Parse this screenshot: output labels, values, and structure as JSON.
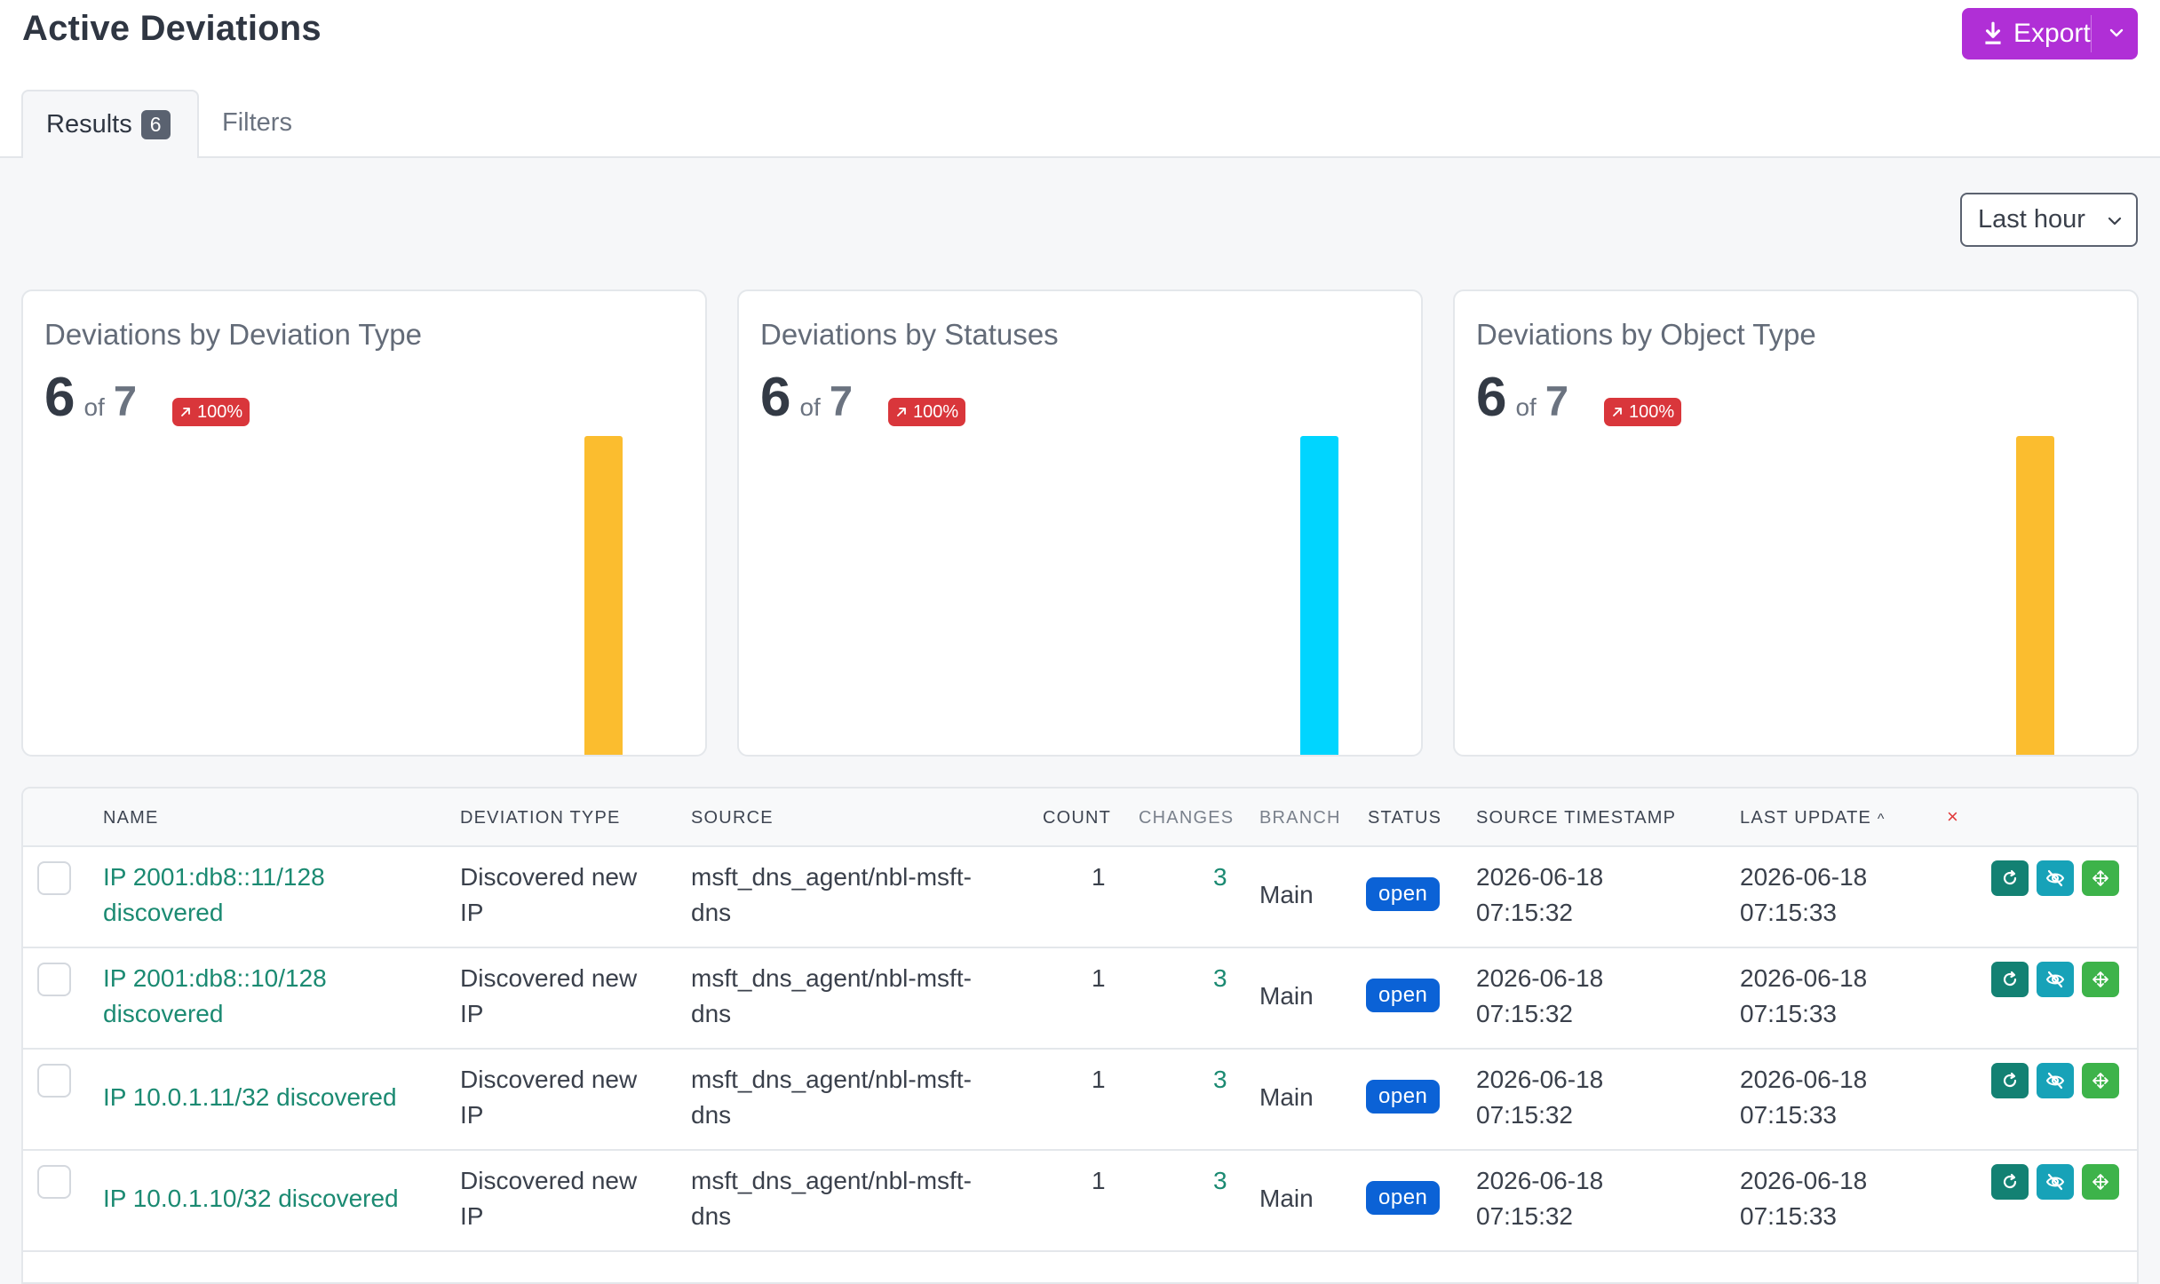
{
  "page": {
    "title": "Active Deviations"
  },
  "header": {
    "export_label": "Export"
  },
  "tabs": [
    {
      "label": "Results",
      "badge": "6"
    },
    {
      "label": "Filters"
    }
  ],
  "time_range": {
    "value": "Last hour"
  },
  "cards": [
    {
      "title": "Deviations by Deviation Type",
      "value": "6",
      "of": "of",
      "total": "7",
      "trend": "100%",
      "bar_color": "#fbbd2f"
    },
    {
      "title": "Deviations by Statuses",
      "value": "6",
      "of": "of",
      "total": "7",
      "trend": "100%",
      "bar_color": "#00d5ff"
    },
    {
      "title": "Deviations by Object Type",
      "value": "6",
      "of": "of",
      "total": "7",
      "trend": "100%",
      "bar_color": "#fbbd2f"
    }
  ],
  "table": {
    "columns": {
      "name": "NAME",
      "deviation_type": "DEVIATION TYPE",
      "source": "SOURCE",
      "count": "COUNT",
      "changes": "CHANGES",
      "branch": "BRANCH",
      "status": "STATUS",
      "source_timestamp": "SOURCE TIMESTAMP",
      "last_update": "LAST UPDATE",
      "sort_indicator": "^",
      "clear": "×"
    },
    "rows": [
      {
        "name_l1": "IP 2001:db8::11/128",
        "name_l2": "discovered",
        "type_l1": "Discovered new",
        "type_l2": "IP",
        "source_l1": "msft_dns_agent/nbl-msft-",
        "source_l2": "dns",
        "count": "1",
        "changes": "3",
        "branch": "Main",
        "status": "open",
        "src_date": "2026-06-18",
        "src_time": "07:15:32",
        "upd_date": "2026-06-18",
        "upd_time": "07:15:33"
      },
      {
        "name_l1": "IP 2001:db8::10/128",
        "name_l2": "discovered",
        "type_l1": "Discovered new",
        "type_l2": "IP",
        "source_l1": "msft_dns_agent/nbl-msft-",
        "source_l2": "dns",
        "count": "1",
        "changes": "3",
        "branch": "Main",
        "status": "open",
        "src_date": "2026-06-18",
        "src_time": "07:15:32",
        "upd_date": "2026-06-18",
        "upd_time": "07:15:33"
      },
      {
        "name_l1": "IP 10.0.1.11/32 discovered",
        "name_l2": "",
        "type_l1": "Discovered new",
        "type_l2": "IP",
        "source_l1": "msft_dns_agent/nbl-msft-",
        "source_l2": "dns",
        "count": "1",
        "changes": "3",
        "branch": "Main",
        "status": "open",
        "src_date": "2026-06-18",
        "src_time": "07:15:32",
        "upd_date": "2026-06-18",
        "upd_time": "07:15:33"
      },
      {
        "name_l1": "IP 10.0.1.10/32 discovered",
        "name_l2": "",
        "type_l1": "Discovered new",
        "type_l2": "IP",
        "source_l1": "msft_dns_agent/nbl-msft-",
        "source_l2": "dns",
        "count": "1",
        "changes": "3",
        "branch": "Main",
        "status": "open",
        "src_date": "2026-06-18",
        "src_time": "07:15:32",
        "upd_date": "2026-06-18",
        "upd_time": "07:15:33"
      }
    ]
  }
}
